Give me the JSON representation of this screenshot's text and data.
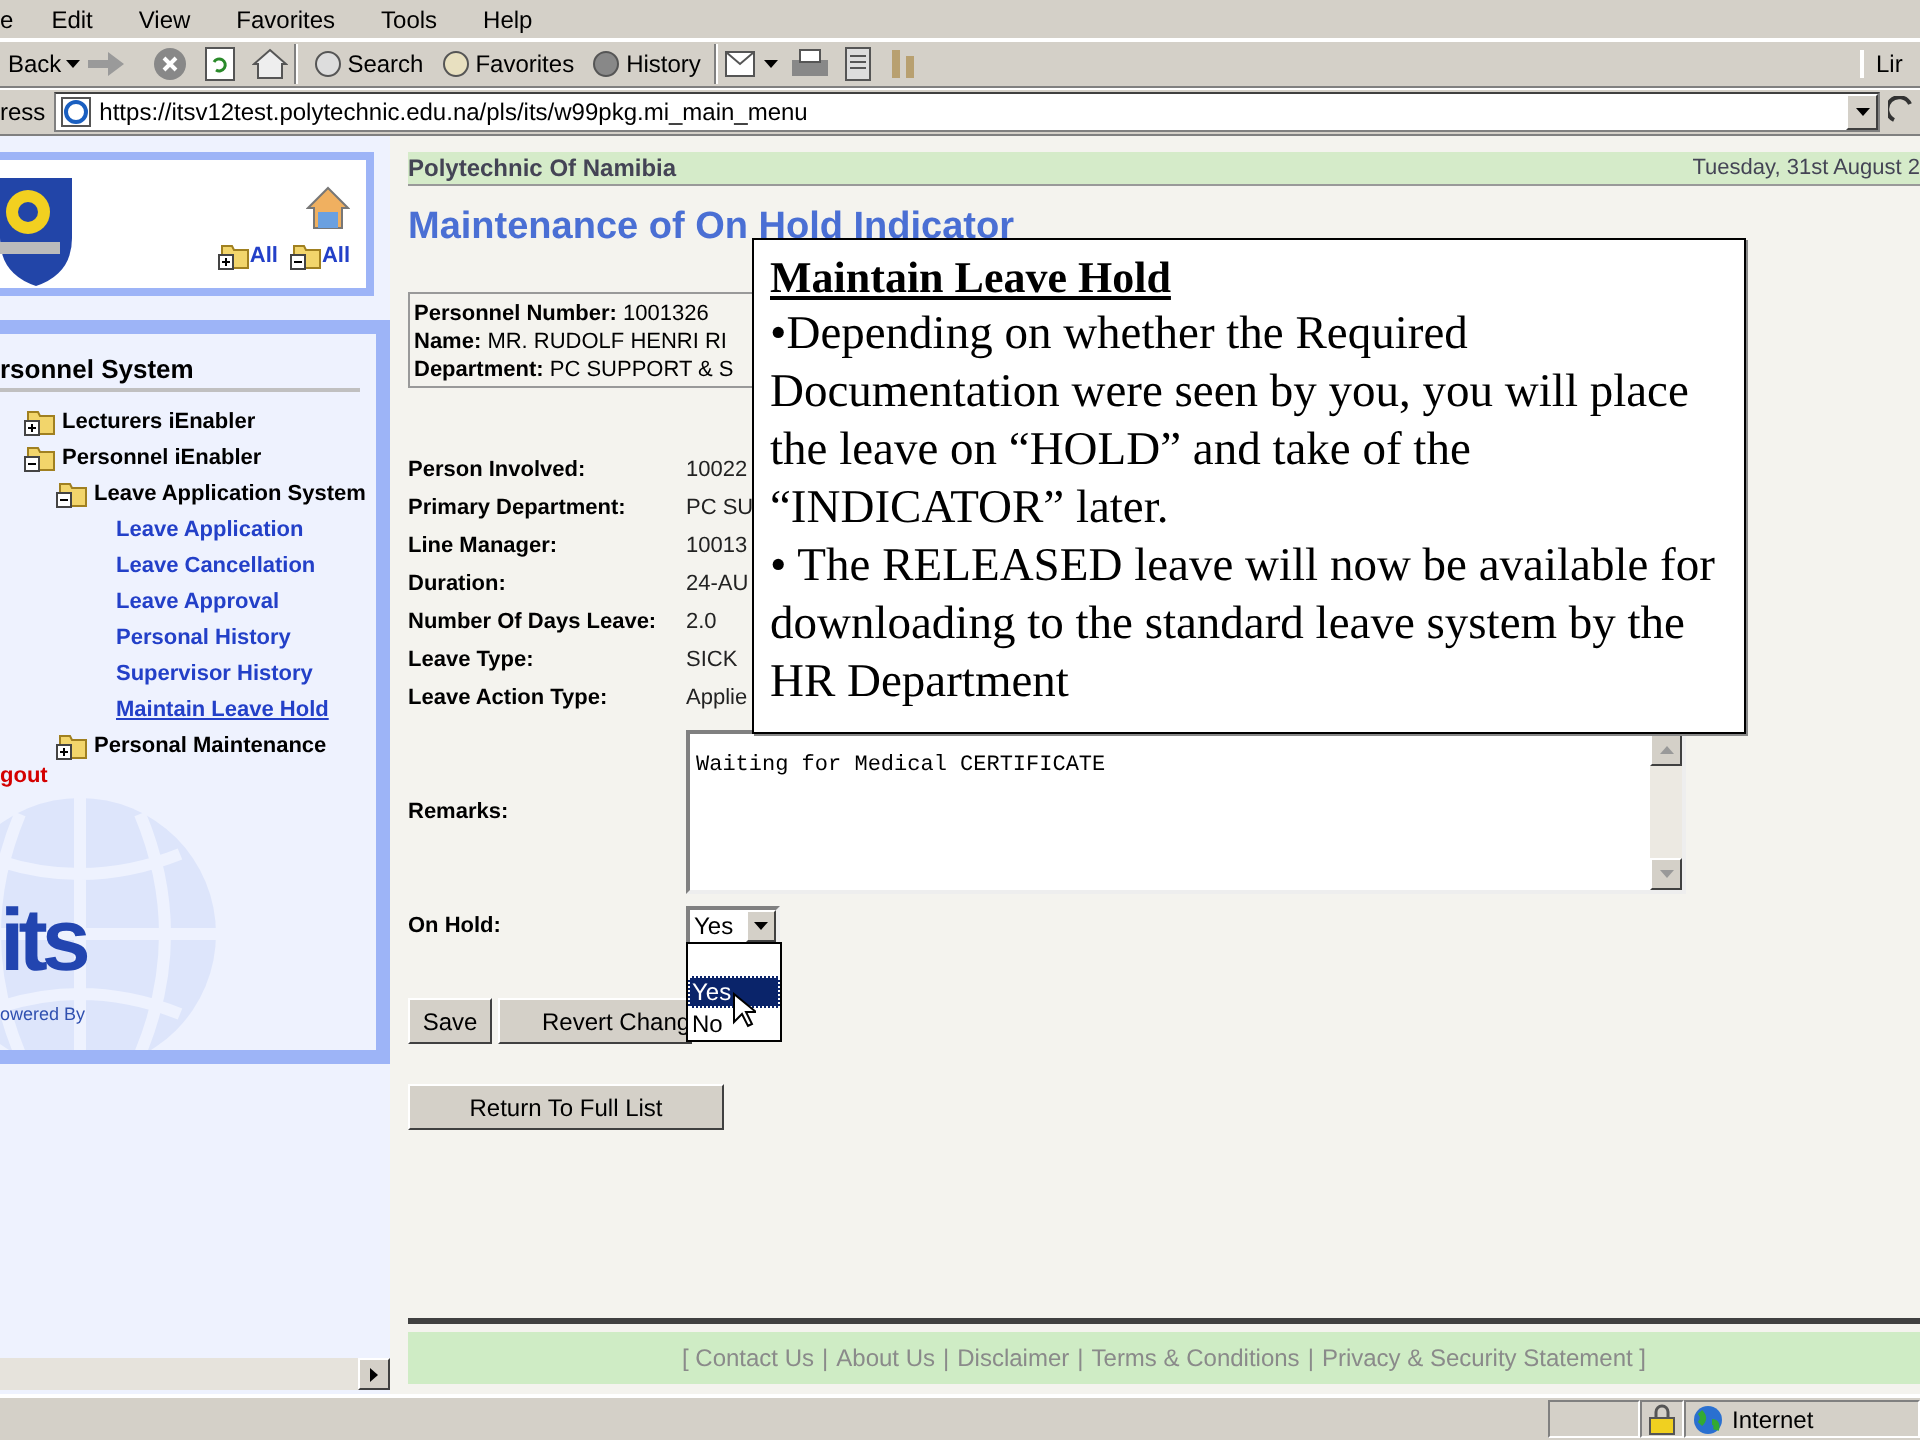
{
  "menu_bar": [
    "e",
    "Edit",
    "View",
    "Favorites",
    "Tools",
    "Help"
  ],
  "toolbar": {
    "back": "Back",
    "buttons": [
      "Search",
      "Favorites",
      "History"
    ],
    "links": "Lir"
  },
  "address_bar": {
    "label": "ress",
    "url": "https://itsv12test.polytechnic.edu.na/pls/its/w99pkg.mi_main_menu"
  },
  "sidebar": {
    "expand_all": "All",
    "collapse_all": "All",
    "section_title": "rsonnel System",
    "tree": [
      {
        "kind": "folder",
        "label": "Lecturers iEnabler",
        "expanded": false
      },
      {
        "kind": "folder",
        "label": "Personnel iEnabler",
        "expanded": true,
        "children": [
          {
            "kind": "folder",
            "label": "Leave Application System",
            "expanded": true,
            "children": [
              {
                "label": "Leave Application",
                "selected": false
              },
              {
                "label": "Leave Cancellation",
                "selected": false
              },
              {
                "label": "Leave Approval",
                "selected": false
              },
              {
                "label": "Personal History",
                "selected": false
              },
              {
                "label": "Supervisor History",
                "selected": false
              },
              {
                "label": "Maintain Leave Hold",
                "selected": true
              }
            ]
          },
          {
            "kind": "folder",
            "label": "Personal Maintenance",
            "expanded": false
          }
        ]
      }
    ],
    "logout": "gout",
    "powered_by": "owered By",
    "brand": "its"
  },
  "header": {
    "institution": "Polytechnic Of Namibia",
    "date": "Tuesday, 31st August 2"
  },
  "page_title": "Maintenance of On Hold Indicator",
  "employee": [
    {
      "label": "Personnel Number:",
      "value": "1001326"
    },
    {
      "label": "Name:",
      "value": "MR. RUDOLF HENRI RI"
    },
    {
      "label": "Department:",
      "value": "PC SUPPORT & S"
    }
  ],
  "fields": [
    {
      "label": "Person Involved:",
      "value": "10022"
    },
    {
      "label": "Primary Department:",
      "value": "PC SU"
    },
    {
      "label": "Line Manager:",
      "value": "10013"
    },
    {
      "label": "Duration:",
      "value": "24-AU"
    },
    {
      "label": "Number Of Days Leave:",
      "value": "2.0"
    },
    {
      "label": "Leave Type:",
      "value": "SICK"
    },
    {
      "label": "Leave Action Type:",
      "value": "Applie"
    }
  ],
  "remarks": {
    "label": "Remarks:",
    "value": "Waiting for Medical CERTIFICATE"
  },
  "on_hold": {
    "label": "On Hold:",
    "value": "Yes",
    "options": [
      {
        "label": "Yes",
        "selected": true
      },
      {
        "label": "No",
        "selected": false
      }
    ]
  },
  "buttons": [
    "Save",
    "Revert Chang"
  ],
  "return_button": "Return To Full List",
  "footer_separator": "|",
  "footer_links": [
    "[ Contact Us",
    "About Us",
    "Disclaimer",
    "Terms & Conditions",
    "Privacy & Security Statement ]"
  ],
  "status_bar": {
    "zone": "Internet"
  },
  "callout": {
    "title": "Maintain Leave Hold",
    "paragraphs": [
      "•Depending on whether the Required Documentation were seen by you, you will place the leave on “HOLD” and take of the “INDICATOR” later.",
      "• The RELEASED leave will now be available for downloading to the standard leave system by the HR Department"
    ]
  }
}
